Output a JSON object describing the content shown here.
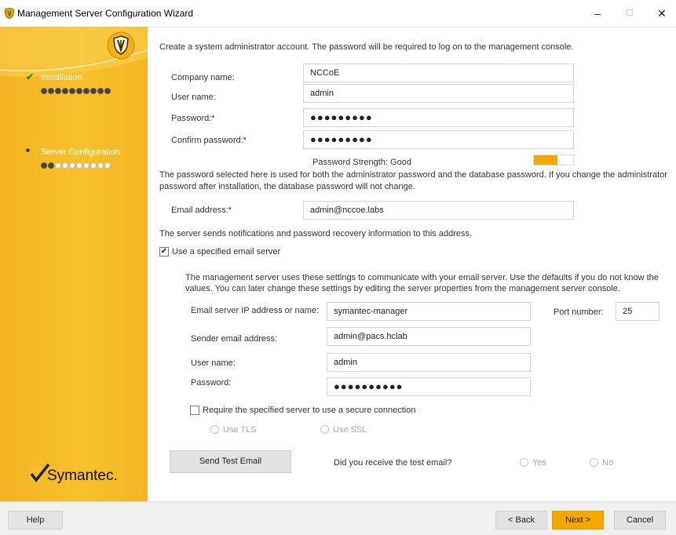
{
  "window": {
    "title": "Management Server Configuration Wizard",
    "controls": {
      "minimize": "–",
      "maximize": "☐",
      "close": "✕"
    }
  },
  "sidebar": {
    "steps": [
      {
        "label": "Installation",
        "status": "complete",
        "marker": "✔",
        "dots_filled": 10,
        "dots_total": 10
      },
      {
        "label": "Server Configuration",
        "status": "current",
        "marker": "■",
        "dots_filled": 2,
        "dots_total": 10
      }
    ],
    "logo_text": "Symantec.",
    "accent_color": "#f7c02b"
  },
  "main": {
    "intro": "Create a system administrator account. The password will be required to log on to the management console.",
    "company_label": "Company name:",
    "company_value": "NCCoE",
    "username_label": "User name:",
    "username_value": "admin",
    "password_label": "Password:*",
    "password_value": "●●●●●●●●●",
    "confirm_label": "Confirm password:*",
    "confirm_value": "●●●●●●●●●",
    "strength_text": "Password Strength: Good",
    "strength_level": 0.6,
    "note_line1": "The password selected here is used for both the administrator password and the database password. If you change the administrator",
    "note_line2": "password after installation, the database password will not change.",
    "email_label": "Email address:*",
    "email_value": "admin@nccoe.labs",
    "notify_text": "The server sends notifications and password recovery information to this address.",
    "use_server_label": "Use a specified email server",
    "use_server_checked": "✔"
  },
  "email_server": {
    "desc_line1": "The management server uses these settings to communicate with your email server.  Use the defaults if you do not know the",
    "desc_line2": "values. You can later change these settings by editing the server properties from the management server console.",
    "ip_label": "Email server IP address or name:",
    "ip_value": "symantec-manager",
    "port_label": "Port number:",
    "port_value": "25",
    "sender_label": "Sender email address:",
    "sender_value": "admin@pacs.hclab",
    "user_label": "User name:",
    "user_value": "admin",
    "pass_label": "Password:",
    "pass_value": "●●●●●●●●●●",
    "secure_label": "Require the specified server to use a secure connection",
    "tls_label": "Use TLS",
    "ssl_label": "Use SSL",
    "test_button": "Send Test Email",
    "received_question": "Did you receive the test email?",
    "yes_label": "Yes",
    "no_label": "No"
  },
  "footer": {
    "help": "Help",
    "back": "< Back",
    "next": "Next >",
    "cancel": "Cancel"
  }
}
